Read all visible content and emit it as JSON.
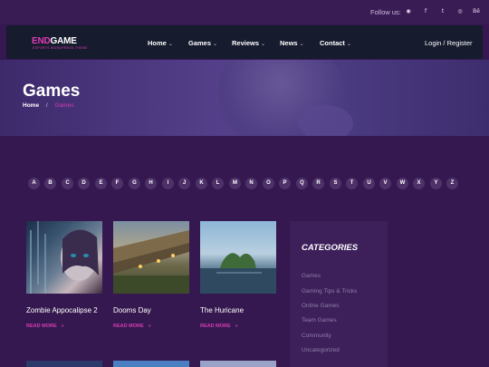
{
  "topbar": {
    "follow_label": "Follow us:",
    "social_icons": [
      "dribbble-icon",
      "facebook-icon",
      "twitter-icon",
      "instagram-icon",
      "behance-icon"
    ],
    "social_glyphs": [
      "◉",
      "f",
      "t",
      "◎",
      "Bē"
    ]
  },
  "nav": {
    "logo": {
      "part1": "END",
      "part2": "GAME"
    },
    "logo_tagline": "ESPORTS WORDPRESS THEME",
    "items": [
      "Home",
      "Games",
      "Reviews",
      "News",
      "Contact"
    ],
    "login": "Login / Register"
  },
  "hero": {
    "title": "Games",
    "breadcrumb": {
      "home": "Home",
      "separator": "/",
      "current": "Games"
    }
  },
  "letters": [
    "A",
    "B",
    "C",
    "D",
    "E",
    "F",
    "G",
    "H",
    "I",
    "J",
    "K",
    "L",
    "M",
    "N",
    "O",
    "P",
    "Q",
    "R",
    "S",
    "T",
    "U",
    "V",
    "W",
    "X",
    "Y",
    "Z"
  ],
  "games": [
    {
      "title": "Zombie Appocalipse 2",
      "read_more": "READ MORE"
    },
    {
      "title": "Dooms Day",
      "read_more": "READ MORE"
    },
    {
      "title": "The Huricane",
      "read_more": "READ MORE"
    }
  ],
  "sidebar": {
    "title": "CATEGORIES",
    "categories": [
      "Games",
      "Gaming Tips & Tricks",
      "Online Games",
      "Team Games",
      "Community",
      "Uncategorized"
    ]
  },
  "colors": {
    "accent": "#d63cb2",
    "background": "#35184f",
    "navbar": "#161b2e"
  }
}
